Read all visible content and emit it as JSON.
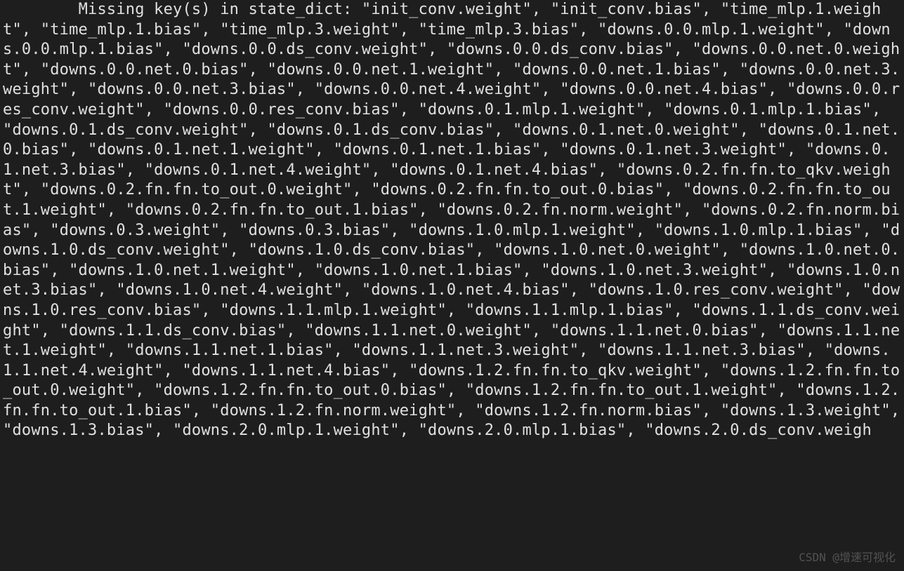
{
  "terminal": {
    "text": "        Missing key(s) in state_dict: \"init_conv.weight\", \"init_conv.bias\", \"time_mlp.1.weight\", \"time_mlp.1.bias\", \"time_mlp.3.weight\", \"time_mlp.3.bias\", \"downs.0.0.mlp.1.weight\", \"downs.0.0.mlp.1.bias\", \"downs.0.0.ds_conv.weight\", \"downs.0.0.ds_conv.bias\", \"downs.0.0.net.0.weight\", \"downs.0.0.net.0.bias\", \"downs.0.0.net.1.weight\", \"downs.0.0.net.1.bias\", \"downs.0.0.net.3.weight\", \"downs.0.0.net.3.bias\", \"downs.0.0.net.4.weight\", \"downs.0.0.net.4.bias\", \"downs.0.0.res_conv.weight\", \"downs.0.0.res_conv.bias\", \"downs.0.1.mlp.1.weight\", \"downs.0.1.mlp.1.bias\", \"downs.0.1.ds_conv.weight\", \"downs.0.1.ds_conv.bias\", \"downs.0.1.net.0.weight\", \"downs.0.1.net.0.bias\", \"downs.0.1.net.1.weight\", \"downs.0.1.net.1.bias\", \"downs.0.1.net.3.weight\", \"downs.0.1.net.3.bias\", \"downs.0.1.net.4.weight\", \"downs.0.1.net.4.bias\", \"downs.0.2.fn.fn.to_qkv.weight\", \"downs.0.2.fn.fn.to_out.0.weight\", \"downs.0.2.fn.fn.to_out.0.bias\", \"downs.0.2.fn.fn.to_out.1.weight\", \"downs.0.2.fn.fn.to_out.1.bias\", \"downs.0.2.fn.norm.weight\", \"downs.0.2.fn.norm.bias\", \"downs.0.3.weight\", \"downs.0.3.bias\", \"downs.1.0.mlp.1.weight\", \"downs.1.0.mlp.1.bias\", \"downs.1.0.ds_conv.weight\", \"downs.1.0.ds_conv.bias\", \"downs.1.0.net.0.weight\", \"downs.1.0.net.0.bias\", \"downs.1.0.net.1.weight\", \"downs.1.0.net.1.bias\", \"downs.1.0.net.3.weight\", \"downs.1.0.net.3.bias\", \"downs.1.0.net.4.weight\", \"downs.1.0.net.4.bias\", \"downs.1.0.res_conv.weight\", \"downs.1.0.res_conv.bias\", \"downs.1.1.mlp.1.weight\", \"downs.1.1.mlp.1.bias\", \"downs.1.1.ds_conv.weight\", \"downs.1.1.ds_conv.bias\", \"downs.1.1.net.0.weight\", \"downs.1.1.net.0.bias\", \"downs.1.1.net.1.weight\", \"downs.1.1.net.1.bias\", \"downs.1.1.net.3.weight\", \"downs.1.1.net.3.bias\", \"downs.1.1.net.4.weight\", \"downs.1.1.net.4.bias\", \"downs.1.2.fn.fn.to_qkv.weight\", \"downs.1.2.fn.fn.to_out.0.weight\", \"downs.1.2.fn.fn.to_out.0.bias\", \"downs.1.2.fn.fn.to_out.1.weight\", \"downs.1.2.fn.fn.to_out.1.bias\", \"downs.1.2.fn.norm.weight\", \"downs.1.2.fn.norm.bias\", \"downs.1.3.weight\", \"downs.1.3.bias\", \"downs.2.0.mlp.1.weight\", \"downs.2.0.mlp.1.bias\", \"downs.2.0.ds_conv.weigh"
  },
  "watermark": "CSDN @增速可视化"
}
